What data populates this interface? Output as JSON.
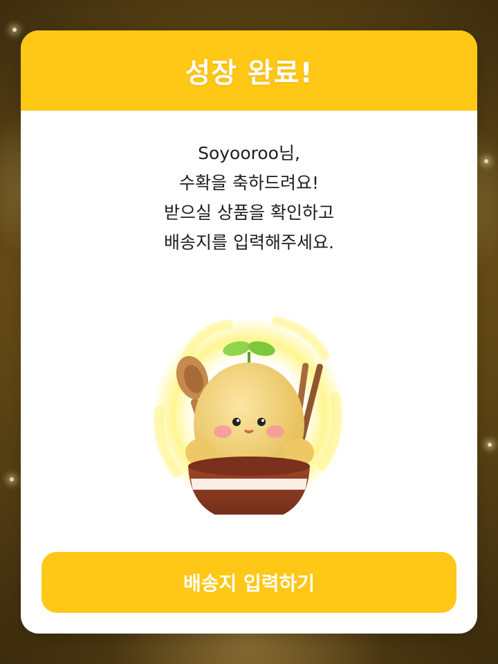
{
  "modal": {
    "title": "성장 완료!",
    "message_lines": [
      "Soyooroo님,",
      "수확을 축하드려요!",
      "받으실 상품을 확인하고",
      "배송지를 입력해주세요."
    ],
    "cta_label": "배송지 입력하기"
  },
  "mascot": {
    "icon": "sprout-mascot-in-bowl-with-spoon-and-chopsticks"
  },
  "colors": {
    "accent": "#ffc716",
    "card": "#ffffff",
    "text": "#1d1d1d",
    "bowl": "#8a3b24",
    "mascot_body": "#f3d27a",
    "sprout": "#7cc83c"
  }
}
